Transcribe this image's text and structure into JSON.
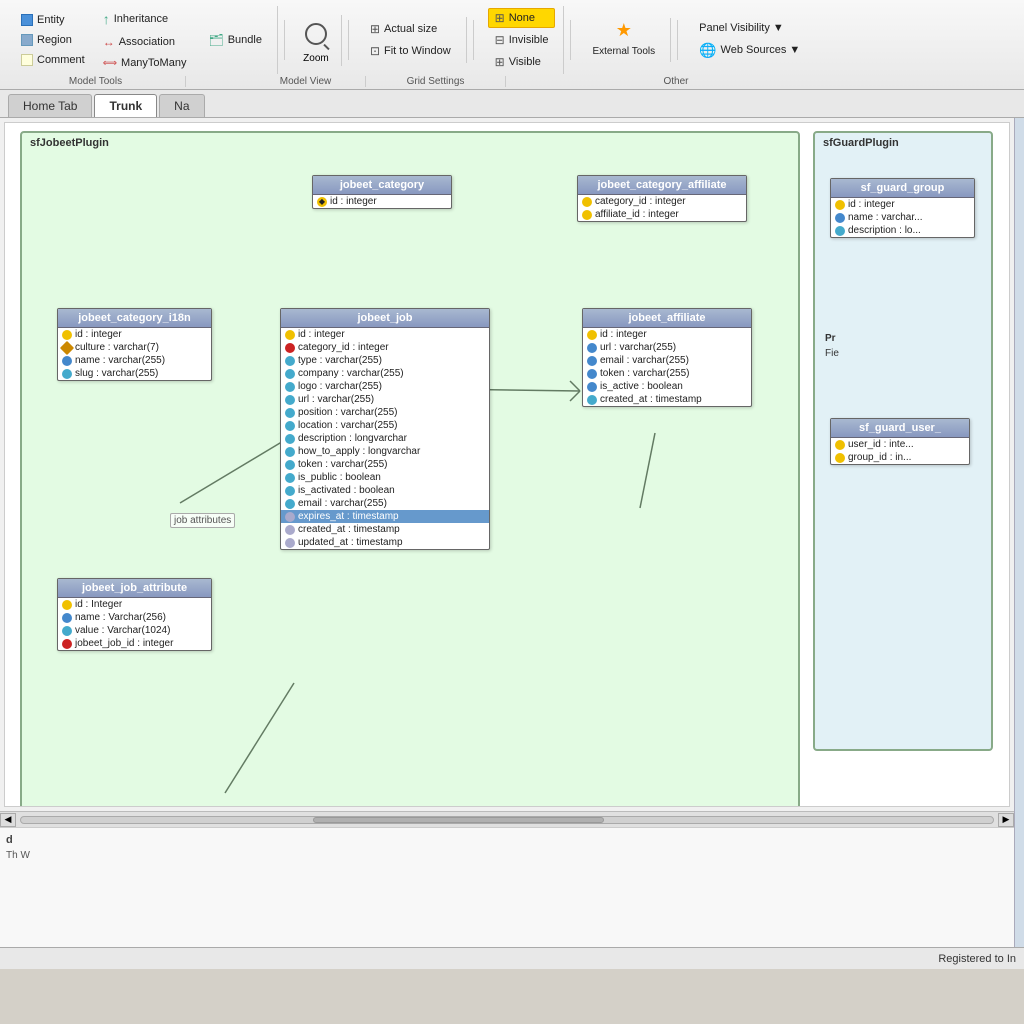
{
  "toolbar": {
    "model_tools_label": "Model Tools",
    "model_view_label": "Model View",
    "grid_settings_label": "Grid Settings",
    "other_label": "Other",
    "entity_label": "Entity",
    "inheritance_label": "Inheritance",
    "bundle_label": "Bundle",
    "region_label": "Region",
    "association_label": "Association",
    "comment_label": "Comment",
    "many_to_many_label": "ManyToMany",
    "zoom_label": "Zoom",
    "actual_size_label": "Actual size",
    "fit_to_window_label": "Fit to Window",
    "none_label": "None",
    "invisible_label": "Invisible",
    "visible_label": "Visible",
    "external_tools_label": "External Tools",
    "panel_visibility_label": "Panel Visibility ▼",
    "web_sources_label": "Web Sources ▼"
  },
  "tabs": {
    "home_tab_label": "Home Tab",
    "trunk_label": "Trunk",
    "na_label": "Na"
  },
  "diagram": {
    "sfjobeet_plugin_label": "sfJobeetPlugin",
    "sfguard_plugin_label": "sfGuardPlugin"
  },
  "entities": {
    "jobeet_category": {
      "name": "jobeet_category",
      "fields": [
        {
          "icon": "pk",
          "text": "id : integer"
        }
      ]
    },
    "jobeet_category_affiliate": {
      "name": "jobeet_category_affiliate",
      "fields": [
        {
          "icon": "pk",
          "text": "category_id : integer"
        },
        {
          "icon": "pk",
          "text": "affiliate_id : integer"
        }
      ]
    },
    "jobeet_category_i18n": {
      "name": "jobeet_category_i18n",
      "fields": [
        {
          "icon": "pk",
          "text": "id : integer"
        },
        {
          "icon": "diamond",
          "text": "culture : varchar(7)"
        },
        {
          "icon": "unique",
          "text": "name : varchar(255)"
        },
        {
          "icon": "optional",
          "text": "slug : varchar(255)"
        }
      ]
    },
    "jobeet_job": {
      "name": "jobeet_job",
      "fields": [
        {
          "icon": "pk",
          "text": "id : integer"
        },
        {
          "icon": "fk",
          "text": "category_id : integer"
        },
        {
          "icon": "optional",
          "text": "type : varchar(255)"
        },
        {
          "icon": "optional",
          "text": "company : varchar(255)"
        },
        {
          "icon": "optional",
          "text": "logo : varchar(255)"
        },
        {
          "icon": "optional",
          "text": "url : varchar(255)"
        },
        {
          "icon": "optional",
          "text": "position : varchar(255)"
        },
        {
          "icon": "optional",
          "text": "location : varchar(255)"
        },
        {
          "icon": "optional",
          "text": "description : longvarchar"
        },
        {
          "icon": "optional",
          "text": "how_to_apply : longvarchar"
        },
        {
          "icon": "optional",
          "text": "token : varchar(255)"
        },
        {
          "icon": "optional",
          "text": "is_public : boolean"
        },
        {
          "icon": "optional",
          "text": "is_activated : boolean"
        },
        {
          "icon": "optional",
          "text": "email : varchar(255)"
        },
        {
          "icon": "selected",
          "text": "expires_at : timestamp"
        },
        {
          "icon": "optional",
          "text": "created_at : timestamp"
        },
        {
          "icon": "optional",
          "text": "updated_at : timestamp"
        }
      ]
    },
    "jobeet_affiliate": {
      "name": "jobeet_affiliate",
      "fields": [
        {
          "icon": "pk",
          "text": "id : integer"
        },
        {
          "icon": "unique",
          "text": "url : varchar(255)"
        },
        {
          "icon": "unique",
          "text": "email : varchar(255)"
        },
        {
          "icon": "unique",
          "text": "token : varchar(255)"
        },
        {
          "icon": "unique",
          "text": "is_active : boolean"
        },
        {
          "icon": "optional",
          "text": "created_at : timestamp"
        }
      ]
    },
    "jobeet_job_attribute": {
      "name": "jobeet_job_attribute",
      "fields": [
        {
          "icon": "pk",
          "text": "id : Integer"
        },
        {
          "icon": "unique",
          "text": "name : Varchar(256)"
        },
        {
          "icon": "optional",
          "text": "value : Varchar(1024)"
        },
        {
          "icon": "fk",
          "text": "jobeet_job_id : integer"
        }
      ]
    },
    "sf_guard_group": {
      "name": "sf_guard_group",
      "fields": [
        {
          "icon": "pk",
          "text": "id : integer"
        },
        {
          "icon": "unique",
          "text": "name : varchar..."
        },
        {
          "icon": "optional",
          "text": "description : lo..."
        }
      ]
    },
    "sf_guard_user": {
      "name": "sf_guard_user_",
      "fields": [
        {
          "icon": "pk",
          "text": "user_id : inte..."
        },
        {
          "icon": "pk",
          "text": "group_id : in..."
        }
      ]
    }
  },
  "description": {
    "label": "d",
    "text": "Th\nW"
  },
  "status": {
    "registered_label": "Registered to In"
  }
}
